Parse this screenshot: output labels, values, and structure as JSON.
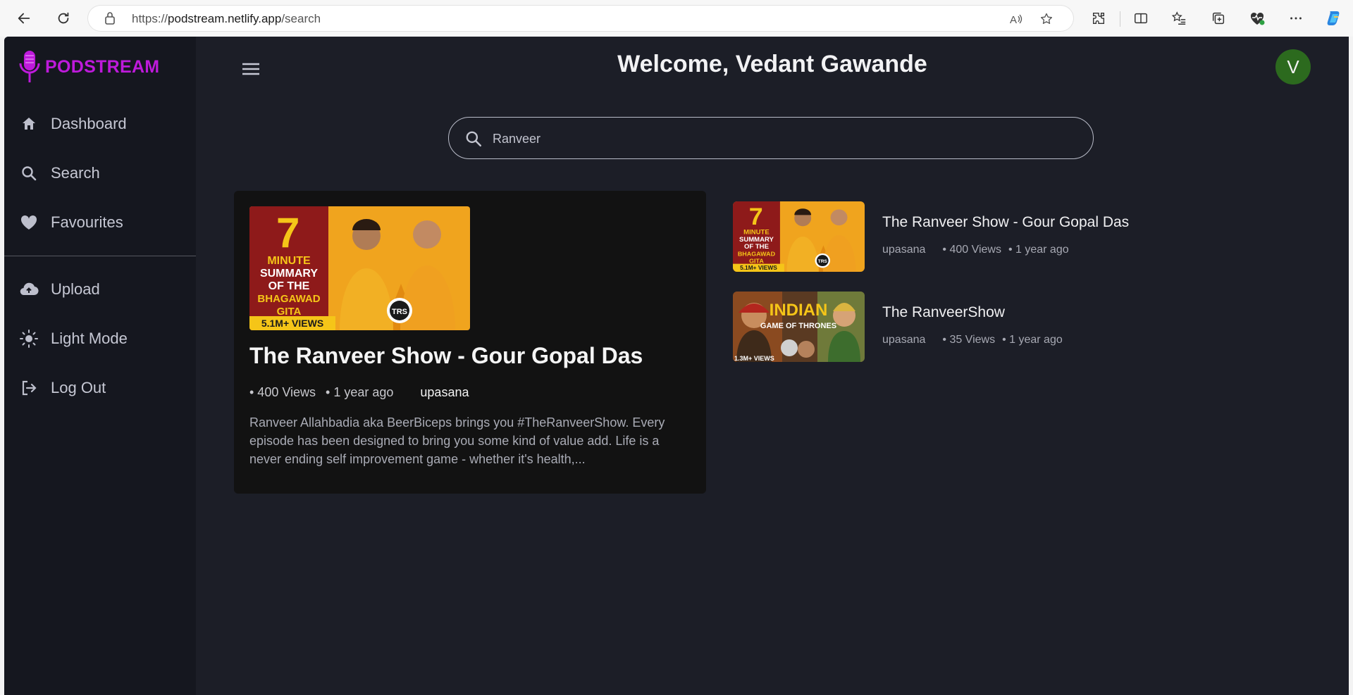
{
  "browser": {
    "url_prefix": "https://",
    "url_host": "podstream.netlify.app",
    "url_path": "/search"
  },
  "sidebar": {
    "logo_text": "PODSTREAM",
    "items": [
      {
        "label": "Dashboard",
        "icon": "home-icon"
      },
      {
        "label": "Search",
        "icon": "search-icon"
      },
      {
        "label": "Favourites",
        "icon": "heart-icon"
      },
      {
        "label": "Upload",
        "icon": "cloud-upload-icon"
      },
      {
        "label": "Light Mode",
        "icon": "sun-icon"
      },
      {
        "label": "Log Out",
        "icon": "logout-icon"
      }
    ]
  },
  "header": {
    "welcome": "Welcome, Vedant Gawande",
    "avatar_initial": "V"
  },
  "search": {
    "value": "Ranveer"
  },
  "featured": {
    "title": "The Ranveer Show - Gour Gopal Das",
    "views": "• 400 Views",
    "age": "• 1 year ago",
    "author": "upasana",
    "description": "Ranveer Allahbadia aka BeerBiceps brings you #TheRanveerShow. Every episode has been designed to bring you some kind of value add. Life is a never ending self improvement game - whether it's health,...",
    "thumb_text": {
      "number": "7",
      "line1": "MINUTE",
      "line2": "SUMMARY",
      "line3": "OF THE",
      "line4": "BHAGAWAD",
      "line5": "GITA",
      "views_badge": "5.1M+ VIEWS",
      "logo": "TRS"
    }
  },
  "results": [
    {
      "title": "The Ranveer Show - Gour Gopal Das",
      "author": "upasana",
      "views": "• 400 Views",
      "age": "• 1 year ago"
    },
    {
      "title": "The RanveerShow",
      "author": "upasana",
      "views": "• 35 Views",
      "age": "• 1 year ago",
      "thumb_text": {
        "line1": "INDIAN",
        "line2": "GAME OF THRONES",
        "badge": "1.3M+ VIEWS"
      }
    }
  ],
  "colors": {
    "brand": "#be1adb",
    "sidebar_bg": "#15171f",
    "main_bg": "#1c1e27",
    "card_bg": "#121212",
    "avatar_bg": "#2c6a1e"
  }
}
